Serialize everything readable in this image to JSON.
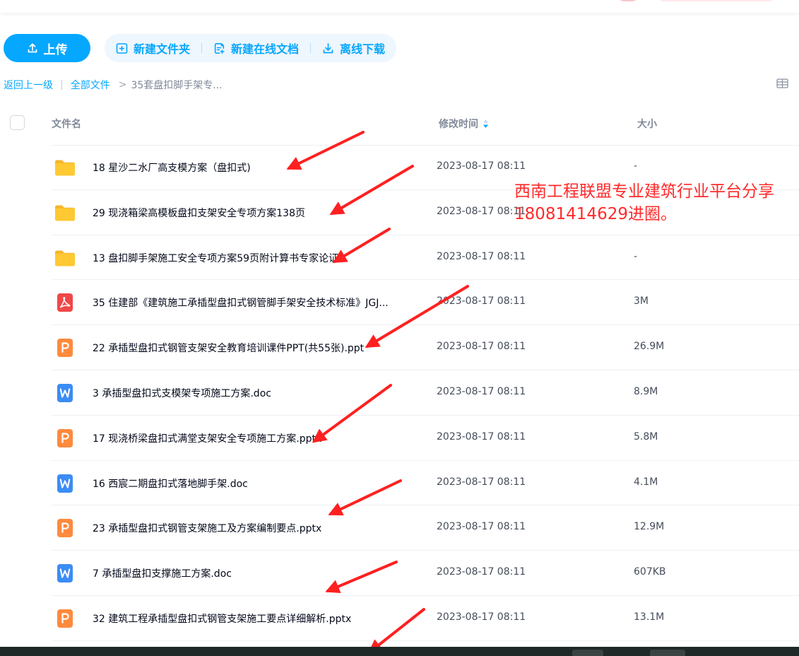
{
  "toolbar": {
    "upload_label": "上传",
    "new_folder_label": "新建文件夹",
    "new_online_doc_label": "新建在线文档",
    "offline_download_label": "离线下载"
  },
  "breadcrumb": {
    "back_label": "返回上一级",
    "root_label": "全部文件",
    "current_label": "35套盘扣脚手架专..."
  },
  "table": {
    "headers": {
      "name": "文件名",
      "modified": "修改时间",
      "size": "大小"
    },
    "rows": [
      {
        "type": "folder",
        "name": "18 星沙二水厂高支模方案（盘扣式)",
        "modified": "2023-08-17 08:11",
        "size": "-"
      },
      {
        "type": "folder",
        "name": "29 现浇箱梁高模板盘扣支架安全专项方案138页",
        "modified": "2023-08-17 08:11",
        "size": ""
      },
      {
        "type": "folder",
        "name": "13 盘扣脚手架施工安全专项方案59页附计算书专家论证",
        "modified": "2023-08-17 08:11",
        "size": "-"
      },
      {
        "type": "pdf",
        "name": "35 住建部《建筑施工承插型盘扣式钢管脚手架安全技术标准》JGJ...",
        "modified": "2023-08-17 08:11",
        "size": "3M"
      },
      {
        "type": "ppt",
        "name": "22 承插型盘扣式钢管支架安全教育培训课件PPT(共55张).ppt",
        "modified": "2023-08-17 08:11",
        "size": "26.9M"
      },
      {
        "type": "word",
        "name": "3 承插型盘扣式支模架专项施工方案.doc",
        "modified": "2023-08-17 08:11",
        "size": "8.9M"
      },
      {
        "type": "ppt",
        "name": "17 现浇桥梁盘扣式满堂支架安全专项施工方案.pptx",
        "modified": "2023-08-17 08:11",
        "size": "5.8M"
      },
      {
        "type": "word",
        "name": "16 西宸二期盘扣式落地脚手架.doc",
        "modified": "2023-08-17 08:11",
        "size": "4.1M"
      },
      {
        "type": "ppt",
        "name": "23 承插型盘扣式钢管支架施工及方案编制要点.pptx",
        "modified": "2023-08-17 08:11",
        "size": "12.9M"
      },
      {
        "type": "word",
        "name": "7 承插型盘扣支撑施工方案.doc",
        "modified": "2023-08-17 08:11",
        "size": "607KB"
      },
      {
        "type": "ppt",
        "name": "32 建筑工程承插型盘扣式钢管支架施工要点详细解析.pptx",
        "modified": "2023-08-17 08:11",
        "size": "13.1M"
      }
    ]
  },
  "overlay": {
    "line1": "西南工程联盟专业建筑行业平台分享",
    "line2": "18081414629进圈。",
    "color": "#ff2a2a"
  },
  "icons": {
    "folder": "folder-icon",
    "pdf": "pdf-file-icon",
    "ppt": "ppt-file-icon",
    "word": "word-file-icon"
  },
  "colors": {
    "accent": "#06a7ff",
    "folder": "#ffc933",
    "pdf": "#f04848",
    "ppt": "#ff8a3d",
    "word": "#3b8cf5"
  }
}
